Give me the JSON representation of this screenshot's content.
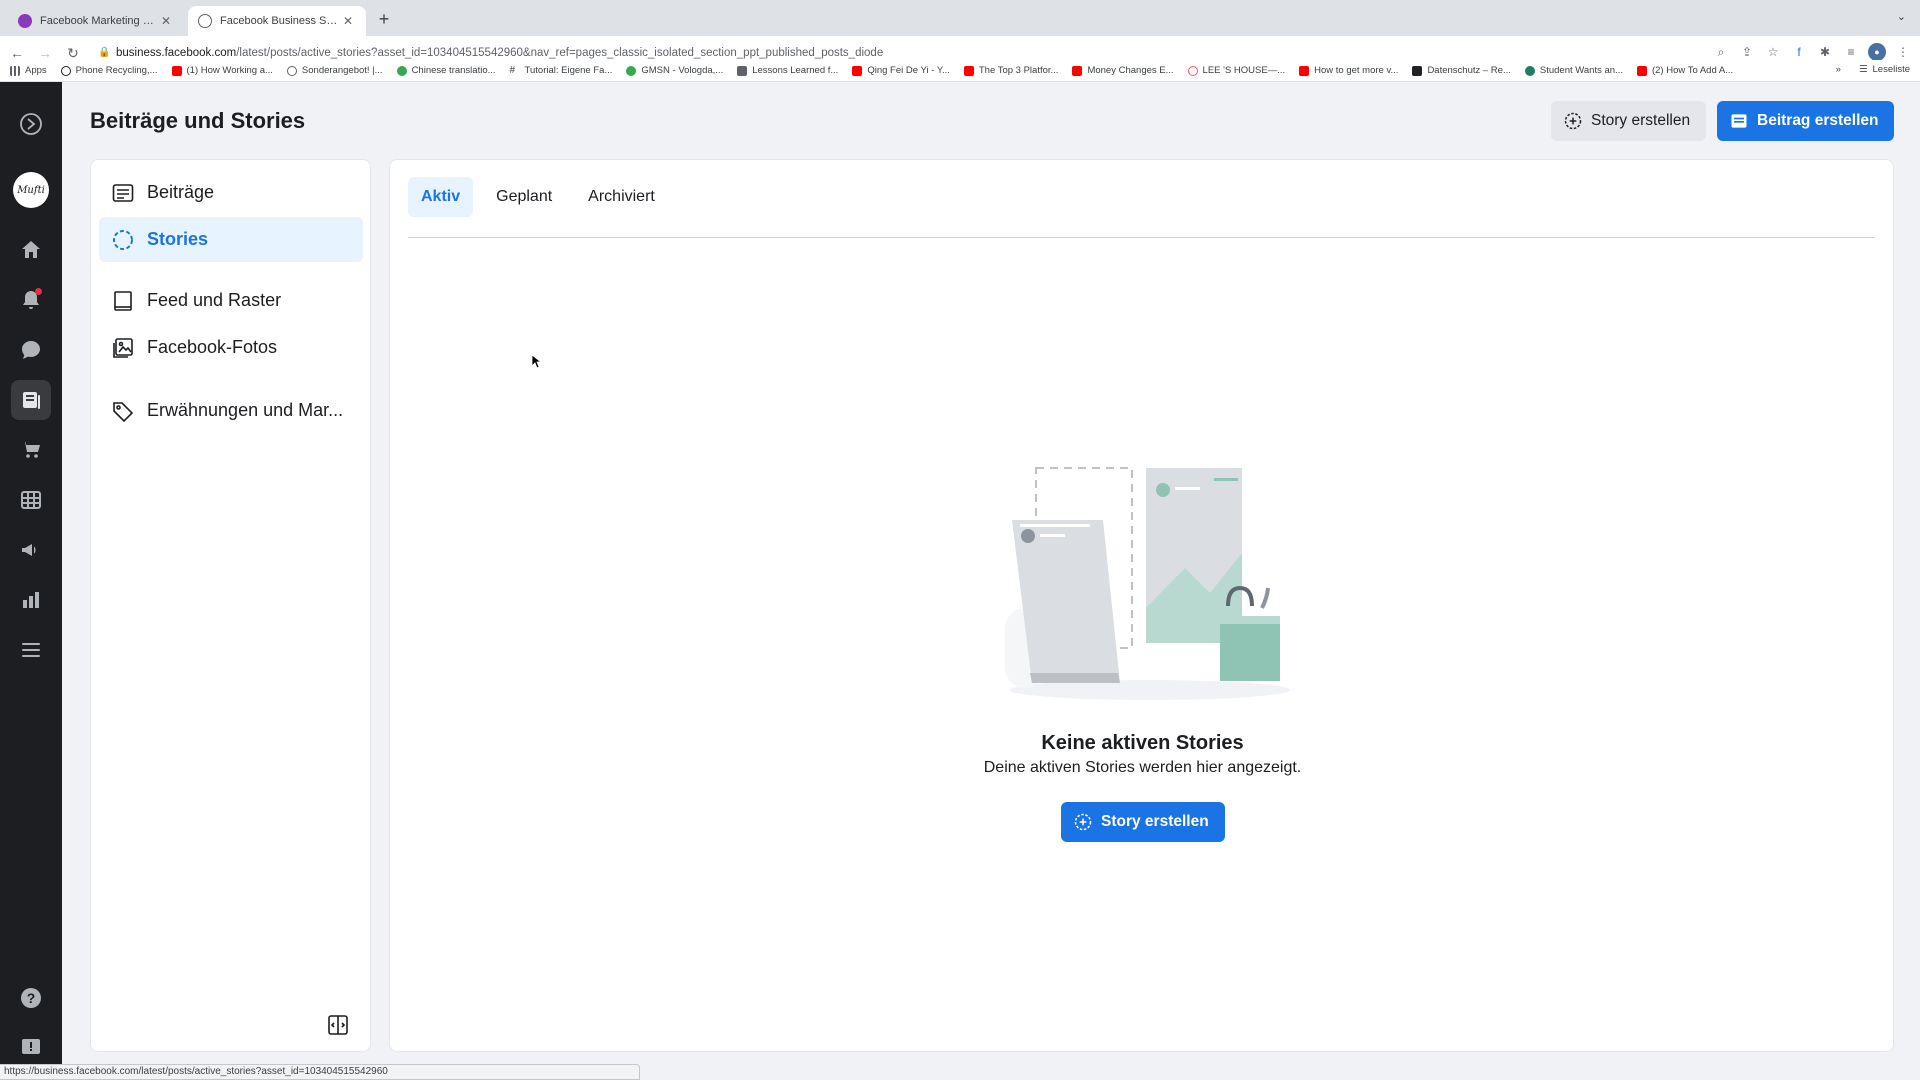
{
  "browser": {
    "tabs": [
      {
        "title": "Facebook Marketing & Werbe...",
        "favicon_color": "#8a3ab9",
        "active": false
      },
      {
        "title": "Facebook Business Suite",
        "favicon_color": "#5f6368",
        "active": true
      }
    ],
    "url_domain": "business.facebook.com",
    "url_path": "/latest/posts/active_stories?asset_id=103404515542960&nav_ref=pages_classic_isolated_section_ppt_published_posts_diode",
    "bookmarks": [
      {
        "label": "Apps",
        "color": "#5f6368"
      },
      {
        "label": "Phone Recycling,...",
        "color": "#202124"
      },
      {
        "label": "(1) How Working a...",
        "color": "#ff0000"
      },
      {
        "label": "Sonderangebot! |...",
        "color": "#5f6368"
      },
      {
        "label": "Chinese translatio...",
        "color": "#34a853"
      },
      {
        "label": "Tutorial: Eigene Fa...",
        "color": "#5f6368"
      },
      {
        "label": "GMSN - Vologda,...",
        "color": "#34a853"
      },
      {
        "label": "Lessons Learned f...",
        "color": "#5f6368"
      },
      {
        "label": "Qing Fei De Yi - Y...",
        "color": "#ff0000"
      },
      {
        "label": "The Top 3 Platfor...",
        "color": "#ff0000"
      },
      {
        "label": "Money Changes E...",
        "color": "#ff0000"
      },
      {
        "label": "LEE 'S HOUSE—...",
        "color": "#ff5a5f"
      },
      {
        "label": "How to get more v...",
        "color": "#ff0000"
      },
      {
        "label": "Datenschutz – Re...",
        "color": "#202124"
      },
      {
        "label": "Student Wants an...",
        "color": "#1a7f64"
      },
      {
        "label": "(2) How To Add A...",
        "color": "#ff0000"
      }
    ],
    "reading_list": "Leseliste",
    "status_url": "https://business.facebook.com/latest/posts/active_stories?asset_id=103404515542960"
  },
  "header": {
    "title": "Beiträge und Stories",
    "story_button": "Story erstellen",
    "post_button": "Beitrag erstellen"
  },
  "sidebar": {
    "items": [
      {
        "label": "Beiträge",
        "icon": "posts-icon"
      },
      {
        "label": "Stories",
        "icon": "stories-icon"
      },
      {
        "label": "Feed und Raster",
        "icon": "feed-icon"
      },
      {
        "label": "Facebook-Fotos",
        "icon": "photos-icon"
      },
      {
        "label": "Erwähnungen und Mar...",
        "icon": "tag-icon"
      }
    ]
  },
  "main": {
    "tabs": [
      "Aktiv",
      "Geplant",
      "Archiviert"
    ],
    "empty_title": "Keine aktiven Stories",
    "empty_subtitle": "Deine aktiven Stories werden hier angezeigt.",
    "empty_button": "Story erstellen"
  },
  "colors": {
    "primary": "#1b74e4",
    "active_bg": "#e7f3ff",
    "nav_bg": "#1c1e21"
  }
}
